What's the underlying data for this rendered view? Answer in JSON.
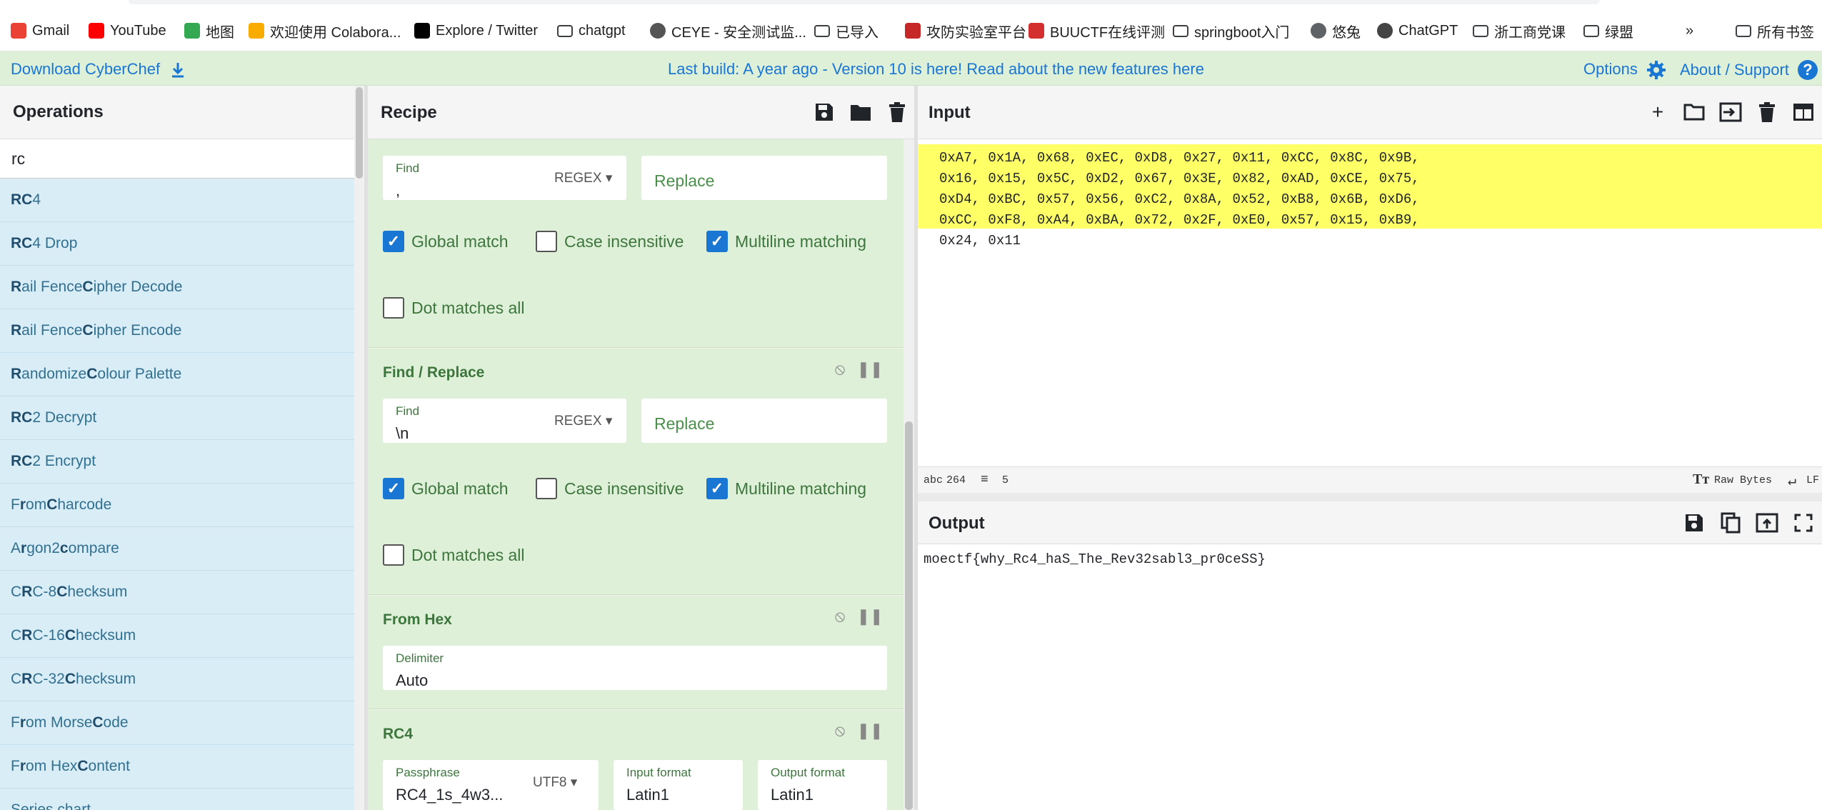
{
  "bookmarks": [
    {
      "label": "Gmail",
      "icon": "gmail-icon"
    },
    {
      "label": "YouTube",
      "icon": "youtube-icon"
    },
    {
      "label": "地图",
      "icon": "maps-icon"
    },
    {
      "label": "欢迎使用 Colabora...",
      "icon": "colab-icon"
    },
    {
      "label": "Explore / Twitter",
      "icon": "x-icon"
    },
    {
      "label": "chatgpt",
      "icon": "folder-icon"
    },
    {
      "label": "CEYE - 安全测试监...",
      "icon": "ceye-icon"
    },
    {
      "label": "已导入",
      "icon": "folder-icon"
    },
    {
      "label": "攻防实验室平台",
      "icon": "lab-icon"
    },
    {
      "label": "BUUCTF在线评测",
      "icon": "buuctf-icon"
    },
    {
      "label": "springboot入门",
      "icon": "folder-icon"
    },
    {
      "label": "悠兔",
      "icon": "globe-icon"
    },
    {
      "label": "ChatGPT",
      "icon": "openai-icon"
    },
    {
      "label": "浙工商党课",
      "icon": "folder-icon"
    },
    {
      "label": "绿盟",
      "icon": "folder-icon"
    }
  ],
  "bookmarks_more": "»",
  "bookmarks_all": "所有书签",
  "banner": {
    "download": "Download CyberChef",
    "build": "Last build: A year ago - Version 10 is here! Read about the new features here",
    "options": "Options",
    "about": "About / Support"
  },
  "operations": {
    "title": "Operations",
    "search_value": "rc",
    "items": [
      {
        "hl": "RC",
        "rest": "4"
      },
      {
        "hl": "RC",
        "rest": "4 Drop"
      },
      {
        "html": "<b>R</b>ail Fence <b>C</b>ipher Decode"
      },
      {
        "html": "<b>R</b>ail Fence <b>C</b>ipher Encode"
      },
      {
        "html": "<b>R</b>andomize <b>C</b>olour Palette"
      },
      {
        "hl": "RC",
        "rest": "2 Decrypt"
      },
      {
        "hl": "RC",
        "rest": "2 Encrypt"
      },
      {
        "html": "F<b>r</b>om <b>C</b>harcode"
      },
      {
        "html": "A<b>r</b>gon2 <b>c</b>ompare"
      },
      {
        "html": "C<b>R</b>C-8 <b>C</b>hecksum"
      },
      {
        "html": "C<b>R</b>C-16 <b>C</b>hecksum"
      },
      {
        "html": "C<b>R</b>C-32 <b>C</b>hecksum"
      },
      {
        "html": "F<b>r</b>om Morse <b>C</b>ode"
      },
      {
        "html": "F<b>r</b>om Hex <b>C</b>ontent"
      },
      {
        "html": "Series chart"
      }
    ]
  },
  "recipe": {
    "title": "Recipe",
    "fr1": {
      "find_label": "Find",
      "find_value": ",",
      "mode": "REGEX",
      "replace_placeholder": "Replace"
    },
    "fr2": {
      "title": "Find / Replace",
      "find_label": "Find",
      "find_value": "\\n",
      "mode": "REGEX",
      "replace_placeholder": "Replace"
    },
    "checks": {
      "global": "Global match",
      "case": "Case insensitive",
      "multiline": "Multiline matching",
      "dot": "Dot matches all"
    },
    "fromhex": {
      "title": "From Hex",
      "delim_label": "Delimiter",
      "delim_value": "Auto"
    },
    "rc4": {
      "title": "RC4",
      "pass_label": "Passphrase",
      "pass_value": "RC4_1s_4w3...",
      "pass_enc": "UTF8",
      "in_label": "Input format",
      "in_value": "Latin1",
      "out_label": "Output format",
      "out_value": "Latin1"
    }
  },
  "input": {
    "title": "Input",
    "lines": [
      "0xA7, 0x1A, 0x68, 0xEC, 0xD8, 0x27, 0x11, 0xCC, 0x8C, 0x9B,",
      "0x16, 0x15, 0x5C, 0xD2, 0x67, 0x3E, 0x82, 0xAD, 0xCE, 0x75,",
      "0xD4, 0xBC, 0x57, 0x56, 0xC2, 0x8A, 0x52, 0xB8, 0x6B, 0xD6,",
      "0xCC, 0xF8, 0xA4, 0xBA, 0x72, 0x2F, 0xE0, 0x57, 0x15, 0xB9,",
      "0x24, 0x11"
    ],
    "status_len_label": "abc",
    "status_len": "264",
    "status_lines": "5",
    "raw_bytes": "Raw Bytes",
    "eol": "LF"
  },
  "output": {
    "title": "Output",
    "text": "moectf{why_Rc4_haS_The_Rev32sabl3_pr0ceSS}"
  },
  "colors": {
    "banner": "#dff0d8",
    "ops_item": "#d9edf7",
    "ingredient": "#dff0d8",
    "input_highlight": "#ffff66",
    "accent": "#1976d2"
  }
}
